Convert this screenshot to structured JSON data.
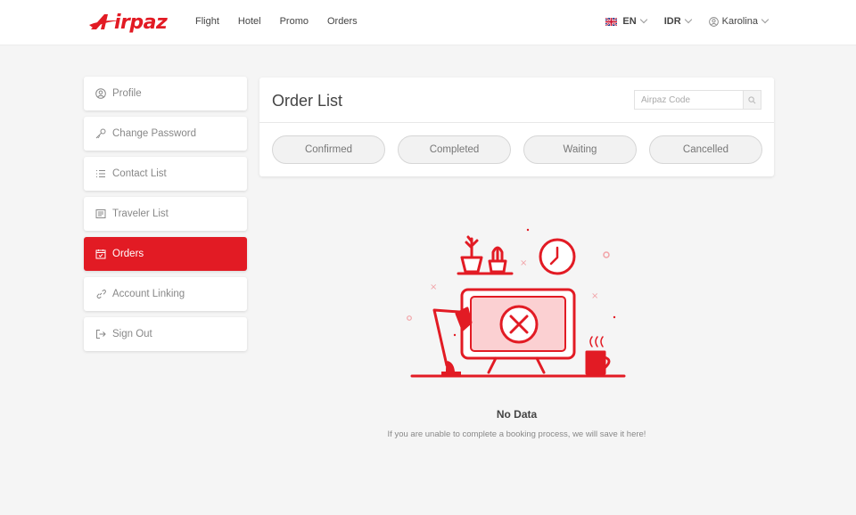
{
  "brand": {
    "logo_text": "irpaz",
    "color": "#e21b24"
  },
  "nav": [
    "Flight",
    "Hotel",
    "Promo",
    "Orders"
  ],
  "header_right": {
    "language": "EN",
    "currency": "IDR",
    "user": "Karolina"
  },
  "sidebar": {
    "items": [
      {
        "label": "Profile",
        "icon": "user-circle-icon"
      },
      {
        "label": "Change Password",
        "icon": "key-icon"
      },
      {
        "label": "Contact List",
        "icon": "list-icon"
      },
      {
        "label": "Traveler List",
        "icon": "id-card-icon"
      },
      {
        "label": "Orders",
        "icon": "calendar-check-icon",
        "active": true
      },
      {
        "label": "Account Linking",
        "icon": "link-icon"
      },
      {
        "label": "Sign Out",
        "icon": "sign-out-icon"
      }
    ]
  },
  "order_panel": {
    "title": "Order List",
    "search_placeholder": "Airpaz Code",
    "tabs": [
      "Confirmed",
      "Completed",
      "Waiting",
      "Cancelled"
    ]
  },
  "empty_state": {
    "title": "No Data",
    "description": "If you are unable to complete a booking process, we will save it here!"
  }
}
